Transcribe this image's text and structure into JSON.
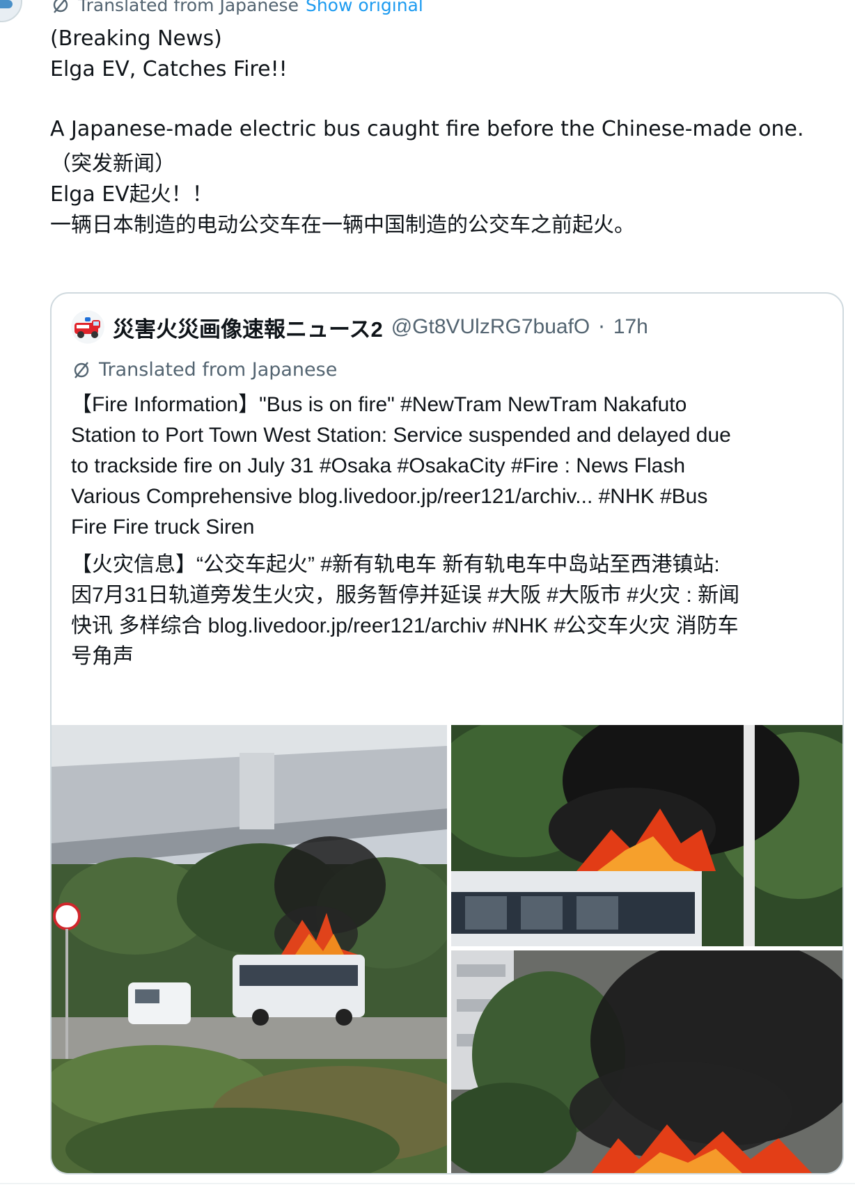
{
  "post": {
    "translated_label": "Translated from Japanese",
    "show_original": "Show original",
    "lines": [
      "(Breaking News)",
      "Elga EV, Catches Fire!!",
      "",
      "A Japanese-made electric bus caught fire before the Chinese-made one.",
      "（突发新闻）",
      "Elga EV起火！！",
      "一辆日本制造的电动公交车在一辆中国制造的公交车之前起火。"
    ]
  },
  "quote": {
    "author_name": "災害火災画像速報ニュース2",
    "handle": "@Gt8VUlzRG7buafO",
    "separator": "·",
    "time": "17h",
    "translated_label": "Translated from Japanese",
    "english_lines": [
      "【Fire Information】\"Bus is on fire\" #NewTram NewTram Nakafuto",
      "Station to Port Town West Station: Service suspended and delayed due",
      "to trackside fire on July 31 #Osaka #OsakaCity #Fire : News Flash",
      "Various Comprehensive blog.livedoor.jp/reer121/archiv... #NHK #Bus",
      "Fire Fire truck Siren"
    ],
    "chinese_lines": [
      "【火灾信息】“公交车起火” #新有轨电车 新有轨电车中岛站至西港镇站:",
      "因7月31日轨道旁发生火灾，服务暂停并延误 #大阪 #大阪市 #火灾 : 新闻",
      "快讯 多样综合 blog.livedoor.jp/reer121/archiv #NHK #公交车火灾 消防车",
      "号角声"
    ]
  },
  "colors": {
    "text": "#0f1419",
    "muted": "#536471",
    "link": "#1d9bf0",
    "border": "#cfd9de"
  },
  "icons": {
    "translate": "translate-icon",
    "avatar": "fire-truck-avatar-icon"
  }
}
